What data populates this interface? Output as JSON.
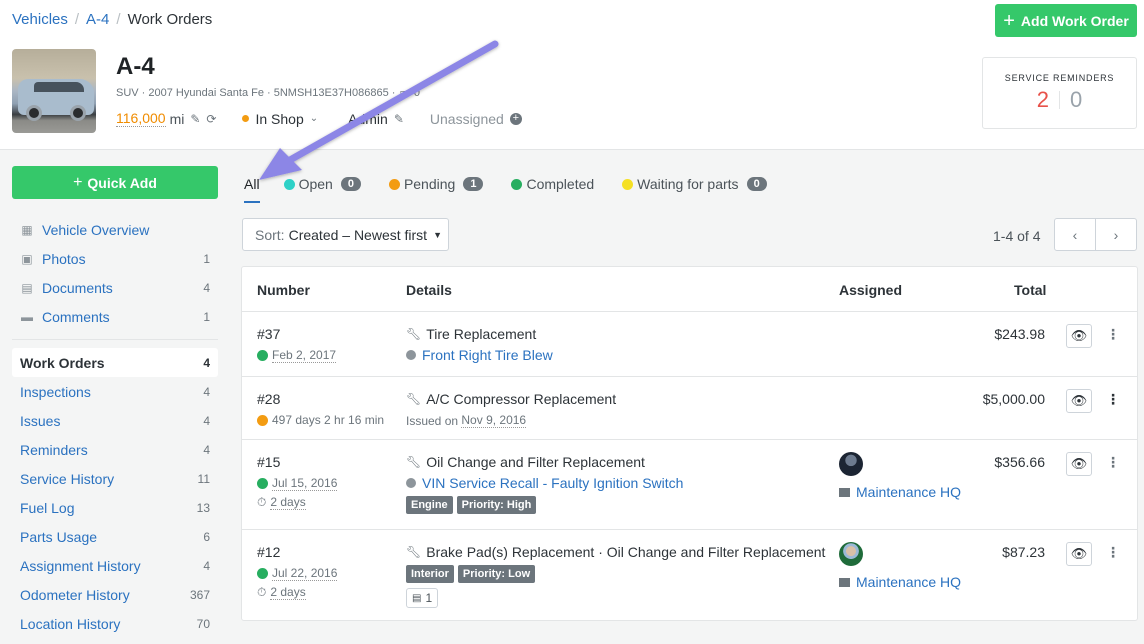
{
  "breadcrumb": {
    "items": [
      "Vehicles",
      "A-4"
    ],
    "current": "Work Orders",
    "separator": "/"
  },
  "header": {
    "add_button": "Add Work Order",
    "vehicle": {
      "name": "A-4",
      "meta": "SUV · 2007 Hyundai Santa Fe · 5NMSH13E37H086865 ·",
      "meta_count": "0",
      "odometer_value": "116,000",
      "odometer_unit": "mi",
      "status": "In Shop",
      "group": "Admin",
      "operator": "Unassigned"
    },
    "service_reminders": {
      "title": "SERVICE REMINDERS",
      "overdue": "2",
      "due_soon": "0"
    }
  },
  "sidebar": {
    "quick_add": "Quick Add",
    "top_items": [
      {
        "label": "Vehicle Overview",
        "count": "",
        "icon": "dashboard-icon"
      },
      {
        "label": "Photos",
        "count": "1",
        "icon": "image-icon"
      },
      {
        "label": "Documents",
        "count": "4",
        "icon": "document-icon"
      },
      {
        "label": "Comments",
        "count": "1",
        "icon": "comment-icon"
      }
    ],
    "items": [
      {
        "label": "Work Orders",
        "count": "4"
      },
      {
        "label": "Inspections",
        "count": "4"
      },
      {
        "label": "Issues",
        "count": "4"
      },
      {
        "label": "Reminders",
        "count": "4"
      },
      {
        "label": "Service History",
        "count": "11"
      },
      {
        "label": "Fuel Log",
        "count": "13"
      },
      {
        "label": "Parts Usage",
        "count": "6"
      },
      {
        "label": "Assignment History",
        "count": "4"
      },
      {
        "label": "Odometer History",
        "count": "367"
      },
      {
        "label": "Location History",
        "count": "70"
      }
    ]
  },
  "tabs": [
    {
      "label": "All",
      "color": "",
      "badge": ""
    },
    {
      "label": "Open",
      "color": "#2ed1c7",
      "badge": "0"
    },
    {
      "label": "Pending",
      "color": "#f39c12",
      "badge": "1"
    },
    {
      "label": "Completed",
      "color": "#27ae60",
      "badge": ""
    },
    {
      "label": "Waiting for parts",
      "color": "#f5e024",
      "badge": "0"
    }
  ],
  "sort": {
    "prefix": "Sort:",
    "value": "Created – Newest first"
  },
  "pagination": {
    "text": "1-4 of 4",
    "prev": "‹",
    "next": "›"
  },
  "table": {
    "columns": [
      "Number",
      "Details",
      "Assigned",
      "Total"
    ],
    "rows": [
      {
        "number": "#37",
        "status_color": "#27ae60",
        "date": "Feb 2, 2017",
        "duration": "",
        "task": "Tire Replacement",
        "issue": "Front Right Tire Blew",
        "issued": "",
        "labels": [],
        "docs": "",
        "assigned": false,
        "location": "",
        "total": "$243.98"
      },
      {
        "number": "#28",
        "status_color": "#f39c12",
        "date": "497 days 2 hr 16 min",
        "duration": "",
        "task": "A/C Compressor Replacement",
        "issue": "",
        "issued_prefix": "Issued on",
        "issued": "Nov 9, 2016",
        "labels": [],
        "docs": "",
        "assigned": false,
        "location": "",
        "total": "$5,000.00"
      },
      {
        "number": "#15",
        "status_color": "#27ae60",
        "date": "Jul 15, 2016",
        "duration": "2 days",
        "task": "Oil Change and Filter Replacement",
        "issue": "VIN Service Recall - Faulty Ignition Switch",
        "issued": "",
        "labels": [
          "Engine",
          "Priority: High"
        ],
        "docs": "",
        "assigned": true,
        "location": "Maintenance HQ",
        "total": "$356.66"
      },
      {
        "number": "#12",
        "status_color": "#27ae60",
        "date": "Jul 22, 2016",
        "duration": "2 days",
        "task": "Brake Pad(s) Replacement · Oil Change and Filter Replacement",
        "issue": "",
        "issued": "",
        "labels": [
          "Interior",
          "Priority: Low"
        ],
        "docs": "1",
        "assigned": true,
        "location": "Maintenance HQ",
        "total": "$87.23"
      }
    ]
  },
  "colors": {
    "accent_green": "#35c86a",
    "link": "#2b72c0",
    "overdue": "#e8524a",
    "annotation_arrow": "#8c86e6"
  }
}
